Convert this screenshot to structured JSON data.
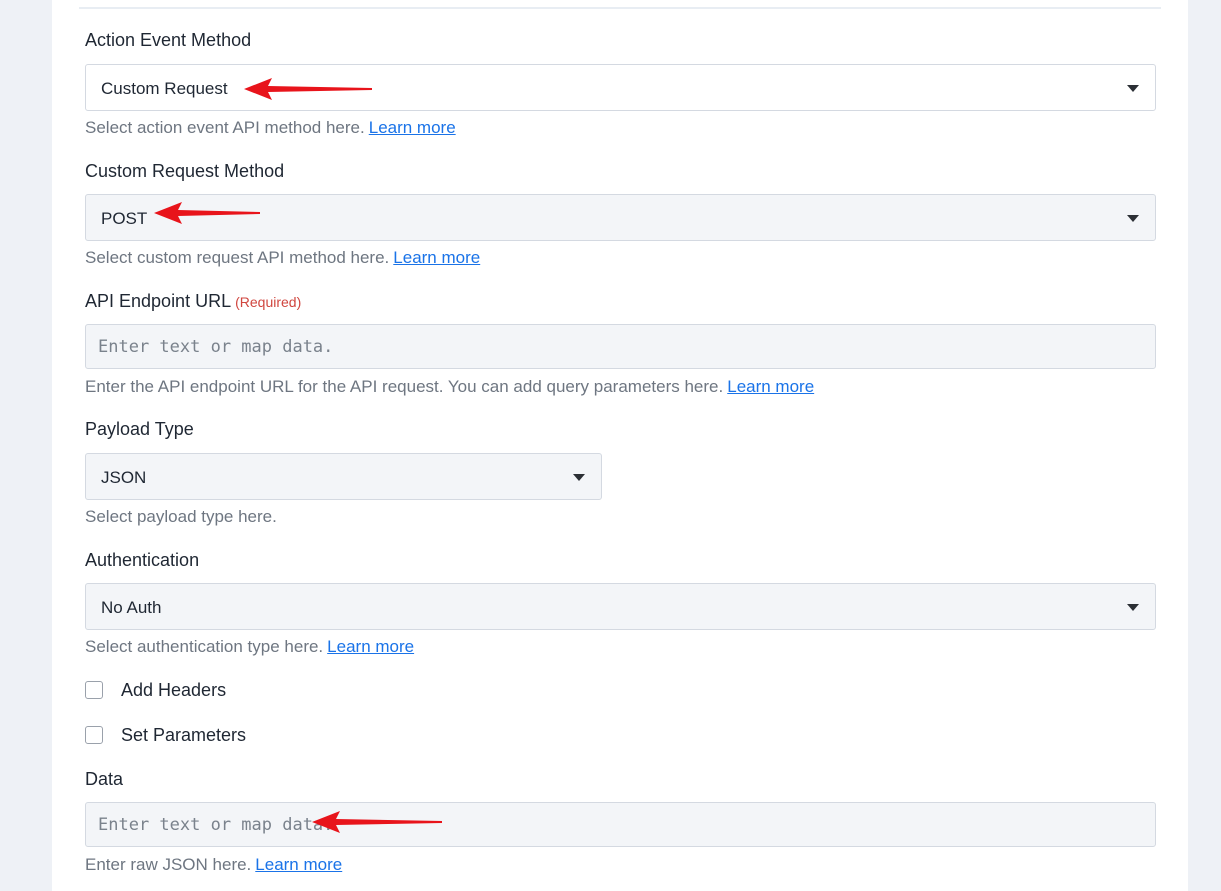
{
  "form": {
    "action_event": {
      "label": "Action Event Method",
      "value": "Custom Request",
      "help": "Select action event API method here.",
      "link": "Learn more"
    },
    "custom_request": {
      "label": "Custom Request Method",
      "value": "POST",
      "help": "Select custom request API method here.",
      "link": "Learn more"
    },
    "endpoint": {
      "label": "API Endpoint URL",
      "required": "(Required)",
      "placeholder": "Enter text or map data.",
      "help": "Enter the API endpoint URL for the API request. You can add query parameters here.",
      "link": "Learn more"
    },
    "payload": {
      "label": "Payload Type",
      "value": "JSON",
      "help": "Select payload type here."
    },
    "auth": {
      "label": "Authentication",
      "value": "No Auth",
      "help": "Select authentication type here.",
      "link": "Learn more"
    },
    "add_headers": {
      "label": "Add Headers",
      "checked": false
    },
    "set_parameters": {
      "label": "Set Parameters",
      "checked": false
    },
    "data": {
      "label": "Data",
      "placeholder": "Enter text or map data.",
      "help": "Enter raw JSON here.",
      "link": "Learn more"
    }
  },
  "colors": {
    "link": "#1a73e8",
    "required": "#d0463f",
    "annotation_arrow": "#e8141b"
  }
}
